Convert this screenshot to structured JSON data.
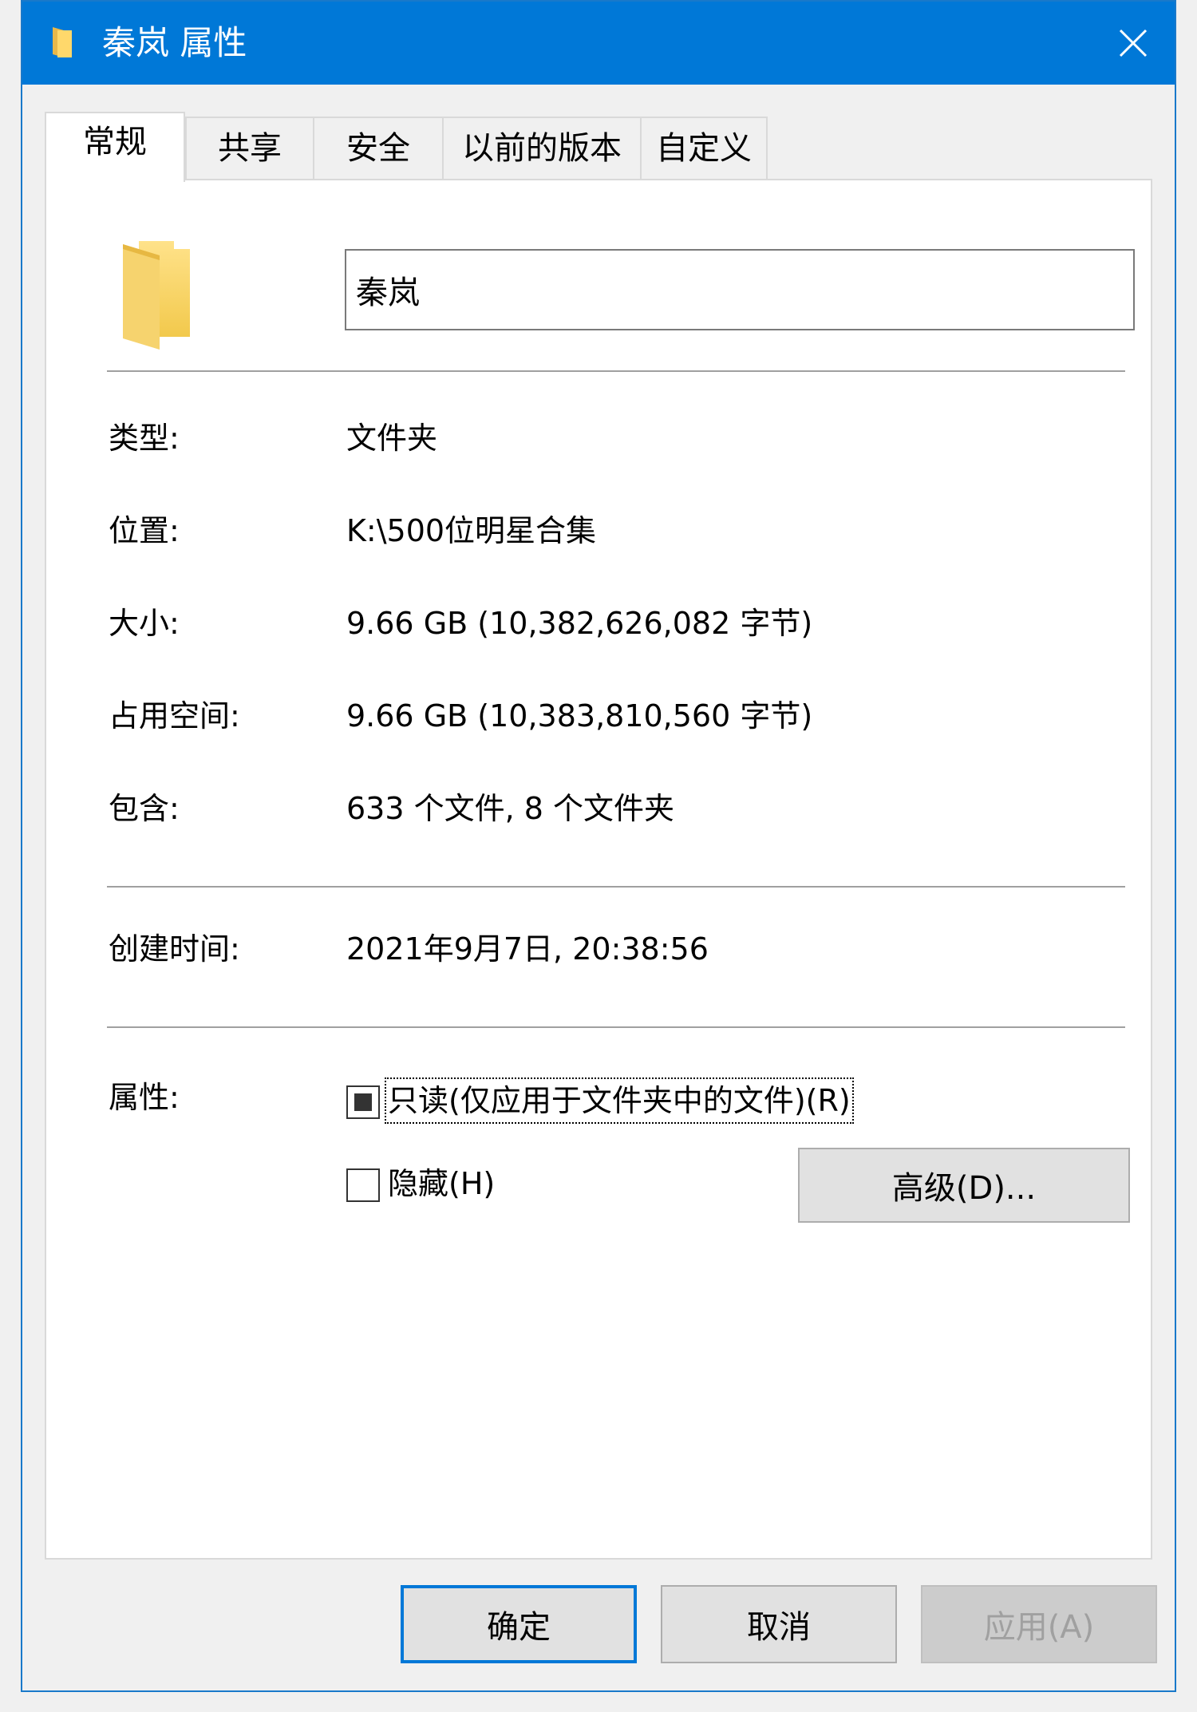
{
  "window": {
    "title": "秦岚 属性",
    "close_icon": "close-icon"
  },
  "tabs": [
    {
      "label": "常规",
      "active": true
    },
    {
      "label": "共享",
      "active": false
    },
    {
      "label": "安全",
      "active": false
    },
    {
      "label": "以前的版本",
      "active": false
    },
    {
      "label": "自定义",
      "active": false
    }
  ],
  "general": {
    "folder_icon": "folder-icon",
    "name_value": "秦岚",
    "type_label": "类型:",
    "type_value": "文件夹",
    "location_label": "位置:",
    "location_value": "K:\\500位明星合集",
    "size_label": "大小:",
    "size_value": "9.66 GB (10,382,626,082 字节)",
    "disk_size_label": "占用空间:",
    "disk_size_value": "9.66 GB (10,383,810,560 字节)",
    "contains_label": "包含:",
    "contains_value": "633 个文件, 8 个文件夹",
    "created_label": "创建时间:",
    "created_value": "2021年9月7日, 20:38:56",
    "attributes_label": "属性:",
    "readonly_label": "只读(仅应用于文件夹中的文件)(R)",
    "readonly_state": "indeterminate",
    "hidden_label": "隐藏(H)",
    "hidden_state": "unchecked",
    "advanced_button": "高级(D)..."
  },
  "footer": {
    "ok_label": "确定",
    "cancel_label": "取消",
    "apply_label": "应用(A)"
  },
  "colors": {
    "titlebar": "#0078d7",
    "folder": "#f5d26a"
  }
}
